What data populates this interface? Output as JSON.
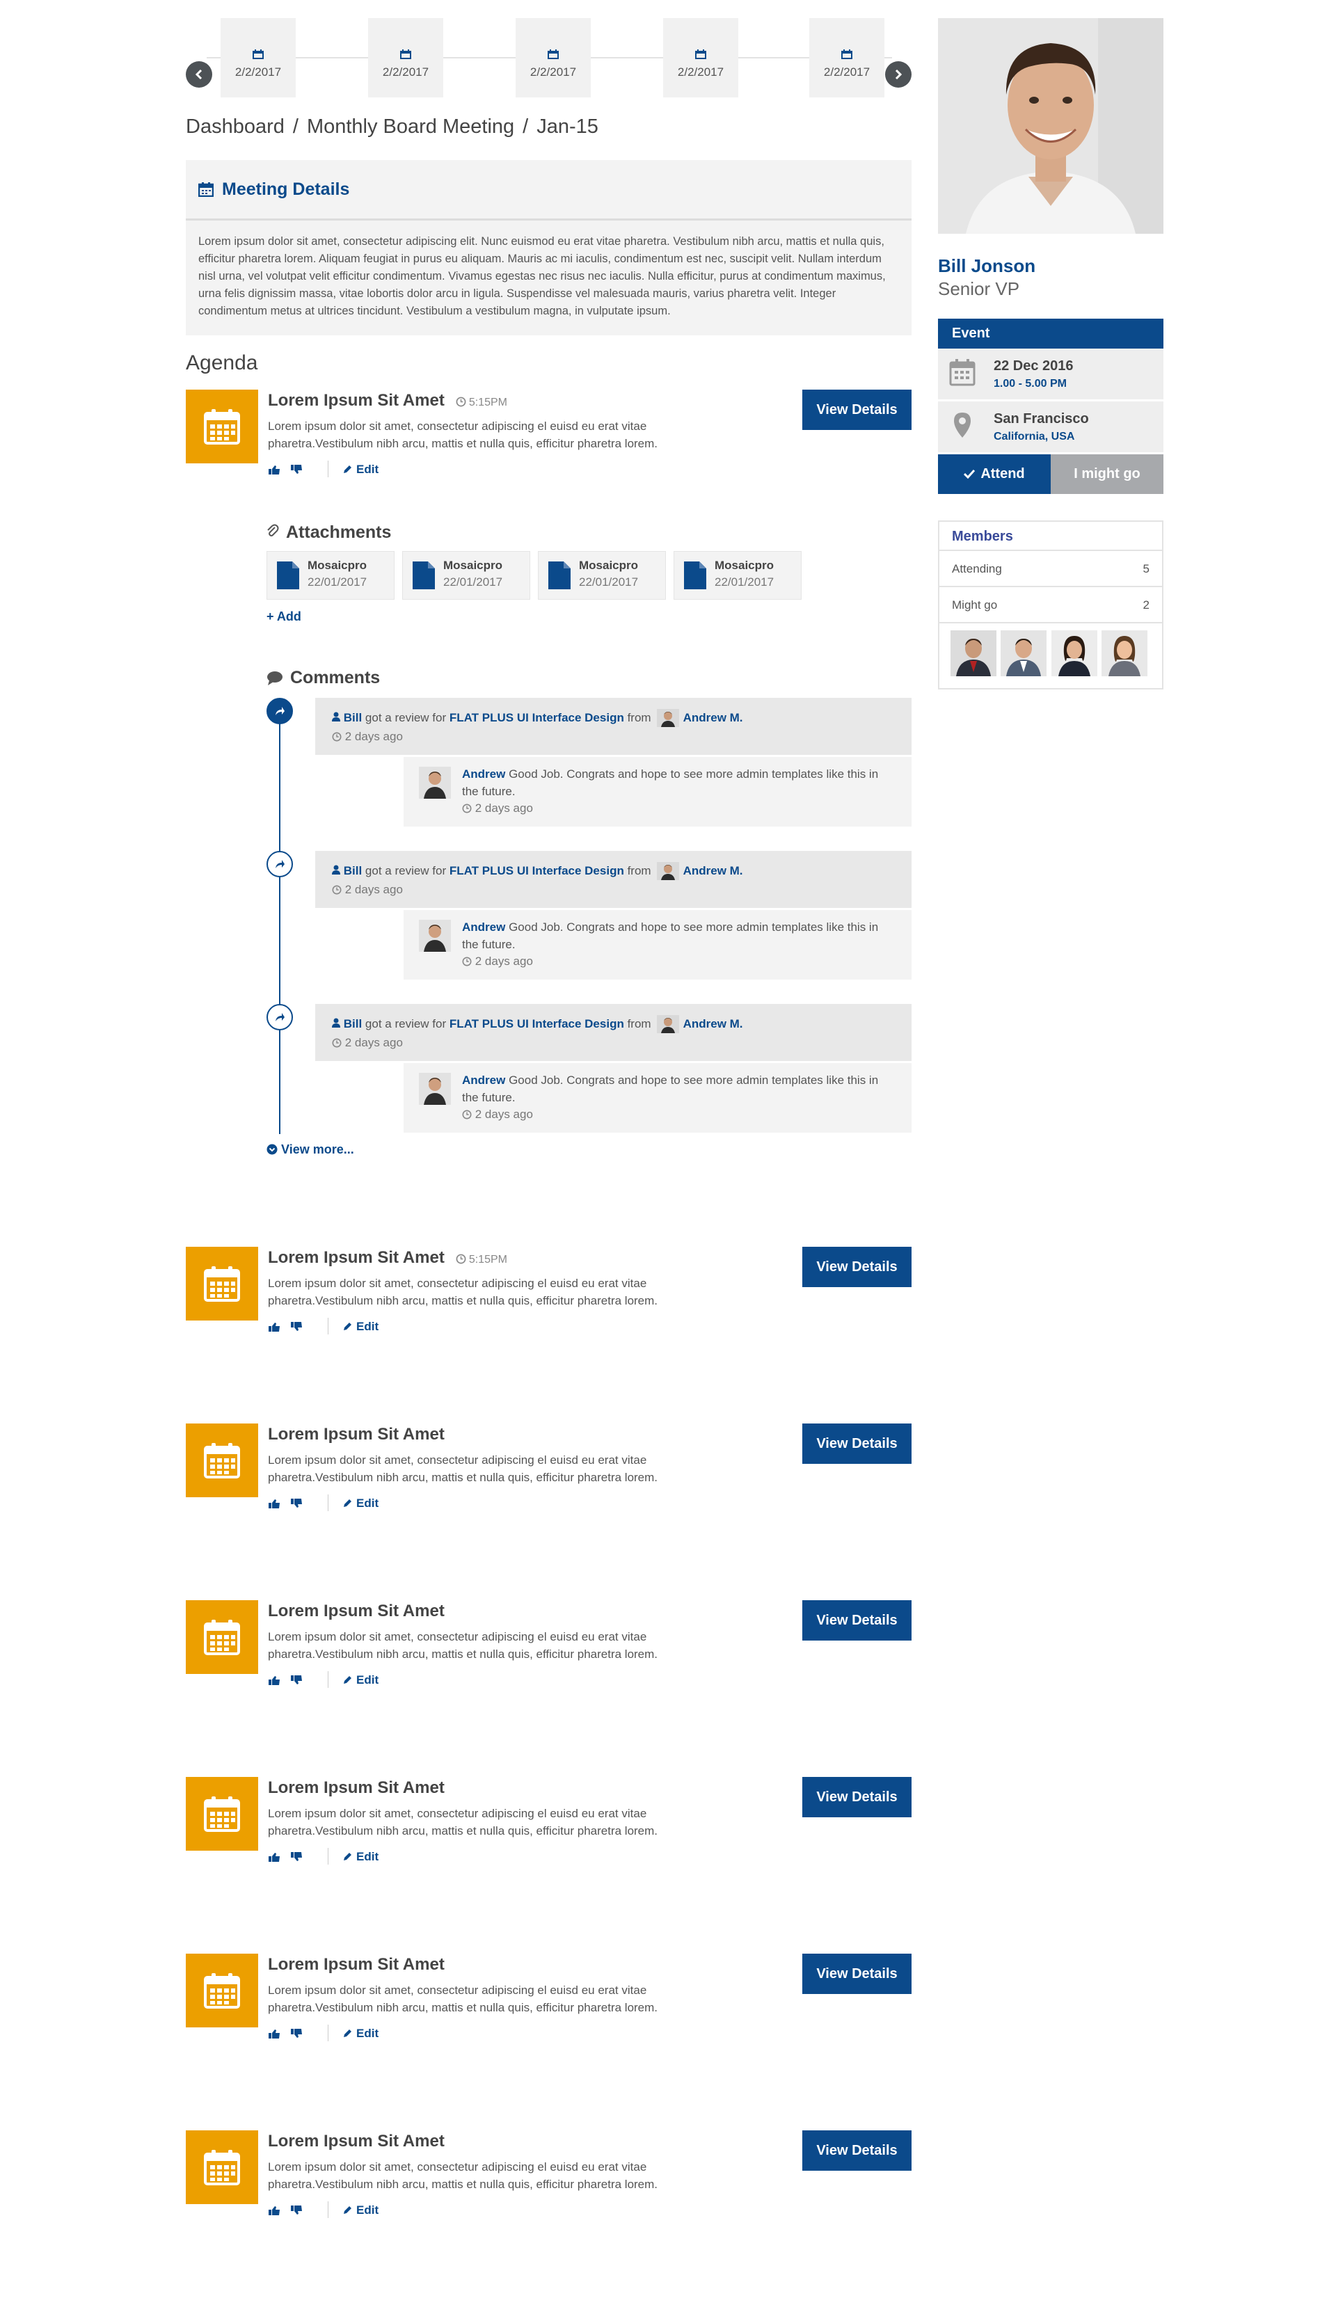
{
  "dates": [
    "2/2/2017",
    "2/2/2017",
    "2/2/2017",
    "2/2/2017",
    "2/2/2017"
  ],
  "breadcrumb": [
    "Dashboard",
    "Monthly Board Meeting",
    "Jan-15"
  ],
  "meeting": {
    "title": "Meeting Details",
    "body": "Lorem ipsum dolor sit amet, consectetur adipiscing elit. Nunc euismod eu erat vitae pharetra. Vestibulum nibh arcu, mattis et nulla quis, efficitur pharetra lorem. Aliquam feugiat in purus eu aliquam. Mauris ac mi iaculis, condimentum est nec, suscipit velit. Nullam interdum nisl urna, vel volutpat velit efficitur condimentum. Vivamus egestas nec risus nec iaculis. Nulla efficitur, purus at condimentum maximus, urna felis dignissim massa, vitae lobortis dolor arcu in ligula. Suspendisse vel malesuada mauris, varius pharetra velit. Integer condimentum metus at ultrices tincidunt. Vestibulum a vestibulum magna, in vulputate ipsum."
  },
  "agenda_title": "Agenda",
  "agenda": [
    {
      "title": "Lorem Ipsum Sit Amet",
      "time": "5:15PM",
      "desc": "Lorem ipsum dolor sit amet, consectetur adipiscing el euisd eu erat vitae pharetra.Vestibulum nibh arcu, mattis et nulla quis, efficitur pharetra lorem.",
      "edit": "Edit",
      "button": "View Details"
    },
    {
      "title": "Lorem Ipsum Sit Amet",
      "time": "5:15PM",
      "desc": "Lorem ipsum dolor sit amet, consectetur adipiscing el euisd eu erat vitae pharetra.Vestibulum nibh arcu, mattis et nulla quis, efficitur pharetra lorem.",
      "edit": "Edit",
      "button": "View Details"
    },
    {
      "title": "Lorem Ipsum Sit Amet",
      "time": "",
      "desc": "Lorem ipsum dolor sit amet, consectetur adipiscing el euisd eu erat vitae pharetra.Vestibulum nibh arcu, mattis et nulla quis, efficitur pharetra lorem.",
      "edit": "Edit",
      "button": "View Details"
    },
    {
      "title": "Lorem Ipsum Sit Amet",
      "time": "",
      "desc": "Lorem ipsum dolor sit amet, consectetur adipiscing el euisd eu erat vitae pharetra.Vestibulum nibh arcu, mattis et nulla quis, efficitur pharetra lorem.",
      "edit": "Edit",
      "button": "View Details"
    },
    {
      "title": "Lorem Ipsum Sit Amet",
      "time": "",
      "desc": "Lorem ipsum dolor sit amet, consectetur adipiscing el euisd eu erat vitae pharetra.Vestibulum nibh arcu, mattis et nulla quis, efficitur pharetra lorem.",
      "edit": "Edit",
      "button": "View Details"
    },
    {
      "title": "Lorem Ipsum Sit Amet",
      "time": "",
      "desc": "Lorem ipsum dolor sit amet, consectetur adipiscing el euisd eu erat vitae pharetra.Vestibulum nibh arcu, mattis et nulla quis, efficitur pharetra lorem.",
      "edit": "Edit",
      "button": "View Details"
    },
    {
      "title": "Lorem Ipsum Sit Amet",
      "time": "",
      "desc": "Lorem ipsum dolor sit amet, consectetur adipiscing el euisd eu erat vitae pharetra.Vestibulum nibh arcu, mattis et nulla quis, efficitur pharetra lorem.",
      "edit": "Edit",
      "button": "View Details"
    }
  ],
  "attachments": {
    "title": "Attachments",
    "add": "Add",
    "files": [
      {
        "name": "Mosaicpro",
        "date": "22/01/2017"
      },
      {
        "name": "Mosaicpro",
        "date": "22/01/2017"
      },
      {
        "name": "Mosaicpro",
        "date": "22/01/2017"
      },
      {
        "name": "Mosaicpro",
        "date": "22/01/2017"
      }
    ]
  },
  "comments": {
    "title": "Comments",
    "view_more": "View more...",
    "items": [
      {
        "user": "Bill",
        "action": "got a review for",
        "project": "FLAT PLUS UI Interface Design",
        "from": "from",
        "reviewer": "Andrew M.",
        "ago": "2 days ago",
        "reply_user": "Andrew",
        "reply_text": "Good Job. Congrats and hope to see more admin templates like this in the future.",
        "reply_ago": "2 days ago"
      },
      {
        "user": "Bill",
        "action": "got a review for",
        "project": "FLAT PLUS UI Interface Design",
        "from": "from",
        "reviewer": "Andrew M.",
        "ago": "2 days ago",
        "reply_user": "Andrew",
        "reply_text": "Good Job. Congrats and hope to see more admin templates like this in the future.",
        "reply_ago": "2 days ago"
      },
      {
        "user": "Bill",
        "action": "got a review for",
        "project": "FLAT PLUS UI Interface Design",
        "from": "from",
        "reviewer": "Andrew M.",
        "ago": "2 days ago",
        "reply_user": "Andrew",
        "reply_text": "Good Job. Congrats and hope to see more admin templates like this in the future.",
        "reply_ago": "2 days ago"
      }
    ]
  },
  "profile": {
    "name": "Bill Jonson",
    "role": "Senior VP"
  },
  "event": {
    "title": "Event",
    "date": "22 Dec 2016",
    "time": "1.00 - 5.00 PM",
    "city": "San Francisco",
    "region": "California, USA",
    "attend": "Attend",
    "maybe": "I might go"
  },
  "members": {
    "title": "Members",
    "rows": [
      {
        "label": "Attending",
        "count": "5"
      },
      {
        "label": "Might go",
        "count": "2"
      }
    ]
  },
  "colors": {
    "brand": "#0b4a8b",
    "accent": "#ec9f00",
    "muted_button": "#a7a9ac"
  }
}
